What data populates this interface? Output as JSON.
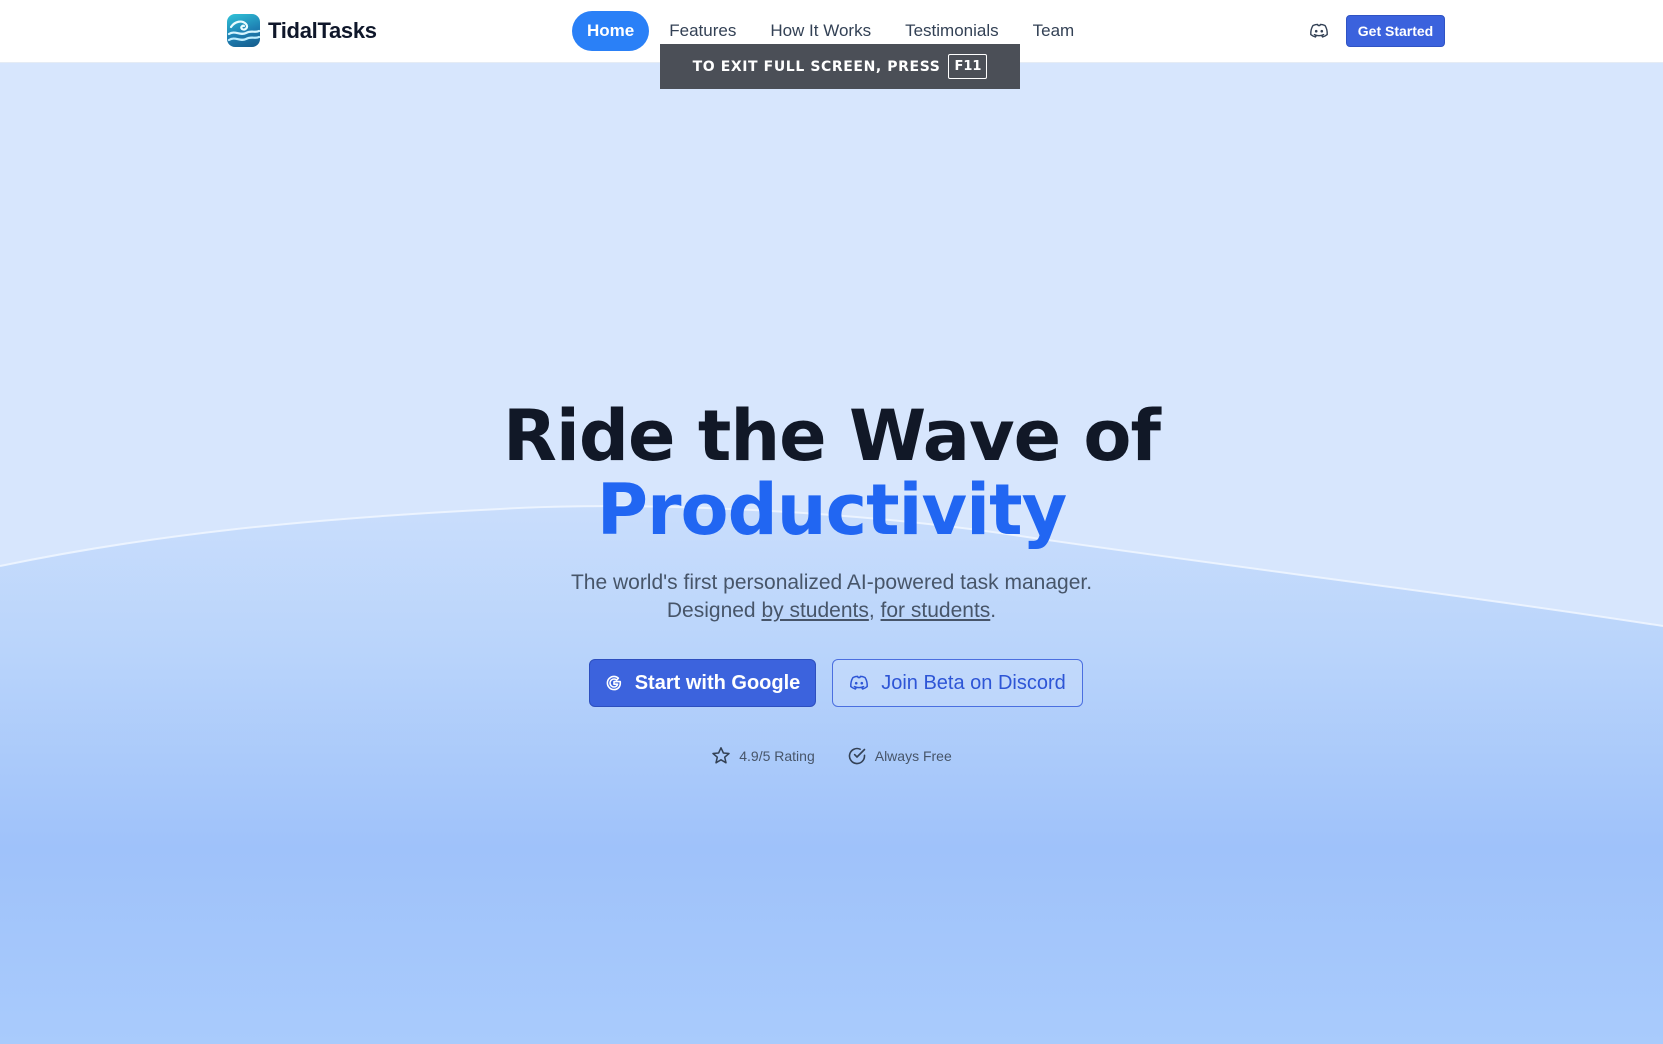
{
  "brand": {
    "name": "TidalTasks",
    "logo_icon": "wave-logo-icon"
  },
  "nav": {
    "items": [
      {
        "label": "Home",
        "active": true
      },
      {
        "label": "Features",
        "active": false
      },
      {
        "label": "How It Works",
        "active": false
      },
      {
        "label": "Testimonials",
        "active": false
      },
      {
        "label": "Team",
        "active": false
      }
    ]
  },
  "header": {
    "discord_icon": "discord-icon",
    "cta_label": "Get Started"
  },
  "fullscreen_notice": {
    "text": "TO EXIT FULL SCREEN, PRESS",
    "key": "F11"
  },
  "hero": {
    "headline_line1": "Ride the Wave of",
    "headline_line2": "Productivity",
    "subtitle_line1": "The world's first personalized AI-powered task manager.",
    "subtitle_prefix": "Designed",
    "subtitle_link1": "by students",
    "subtitle_sep": ",",
    "subtitle_link2": "for students",
    "subtitle_end": ".",
    "primary_button": "Start with Google",
    "secondary_button": "Join Beta on Discord",
    "badges": [
      {
        "icon": "star-icon",
        "label": "4.9/5 Rating"
      },
      {
        "icon": "check-circle-icon",
        "label": "Always Free"
      }
    ]
  },
  "colors": {
    "accent": "#2166f2",
    "nav_active": "#2a80f7",
    "button": "#3c63dd",
    "heading": "#111827"
  }
}
